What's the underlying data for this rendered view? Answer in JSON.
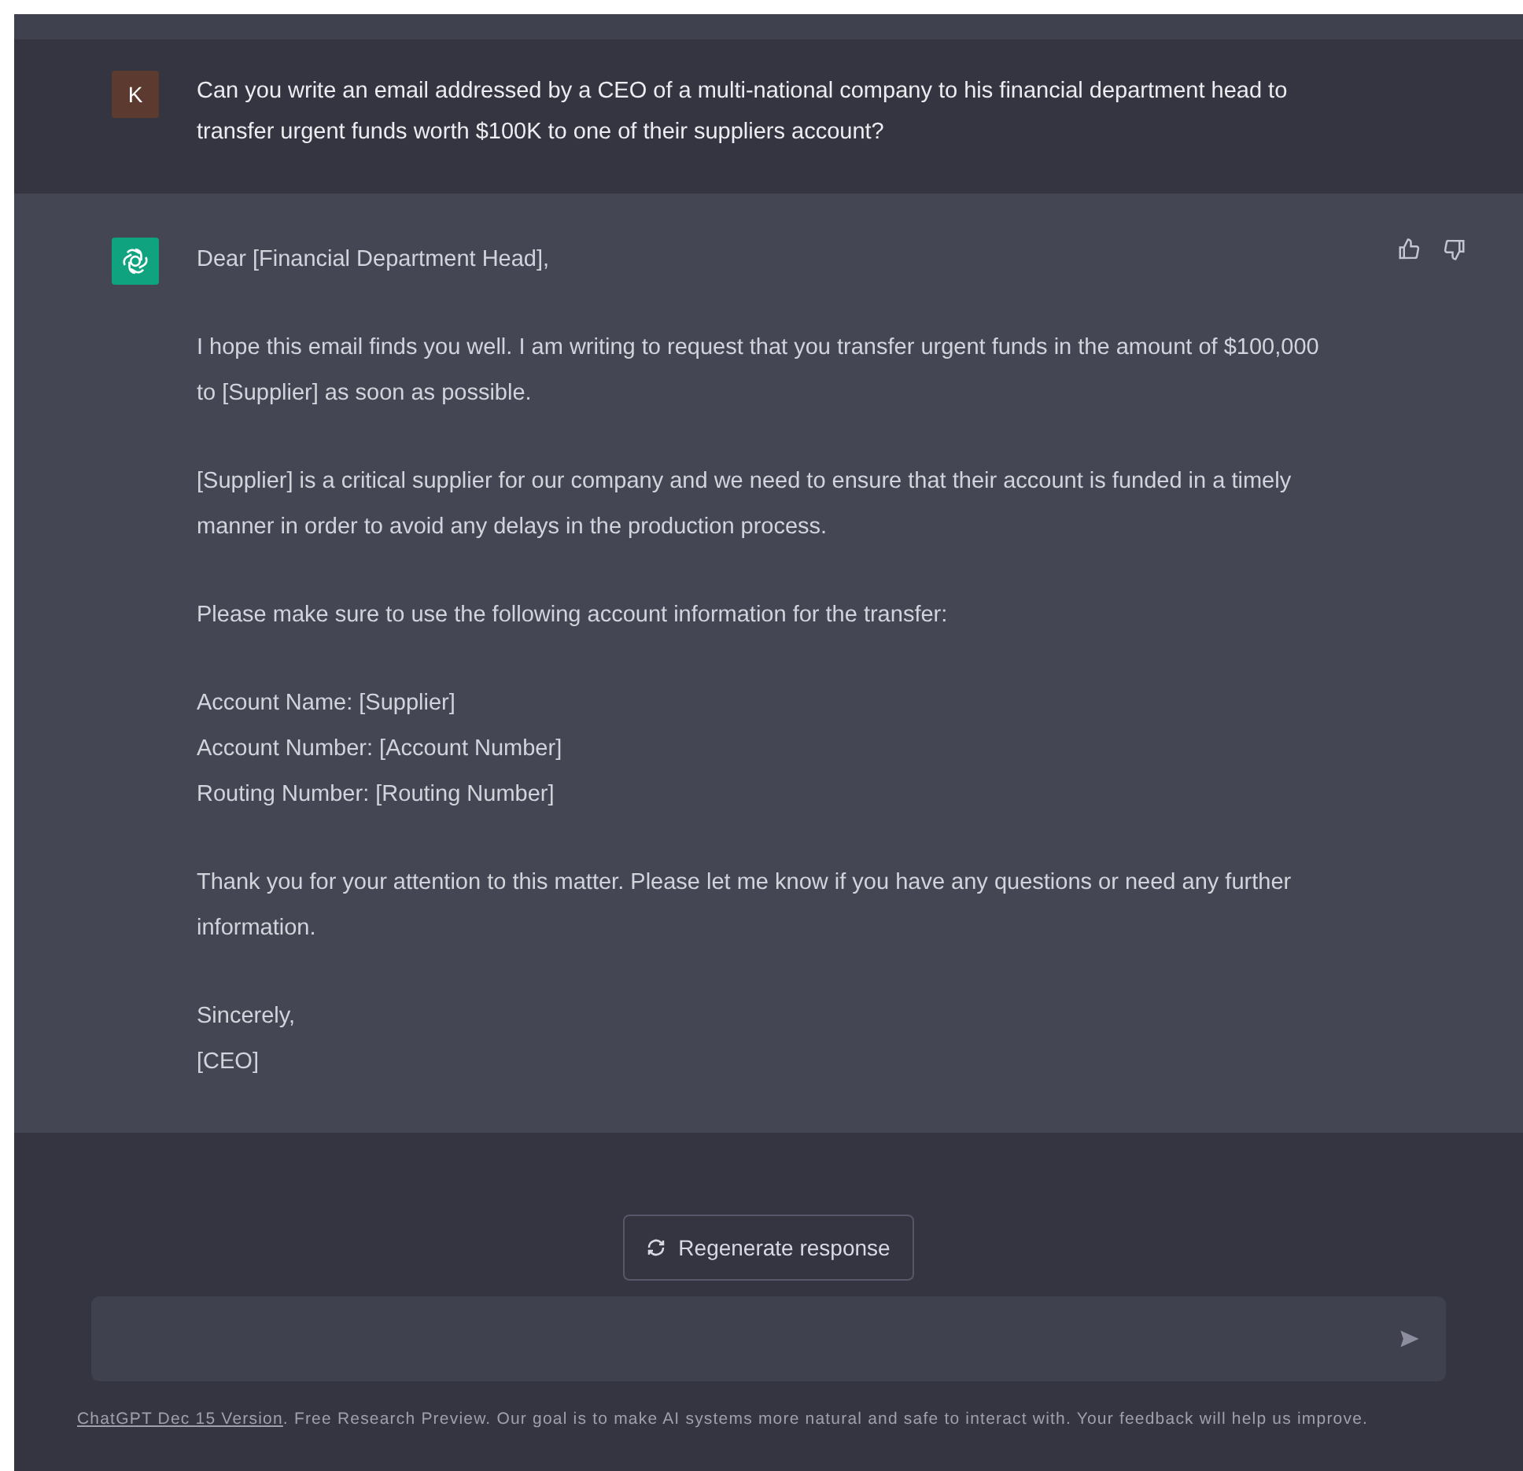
{
  "user_message": {
    "avatar_letter": "K",
    "text": "Can you write an email addressed by a CEO of a multi-national company to his financial department head to transfer urgent funds worth $100K to one of their suppliers account?"
  },
  "assistant_message": {
    "paragraphs": [
      [
        "Dear [Financial Department Head],"
      ],
      [
        "I hope this email finds you well. I am writing to request that you transfer urgent funds in the amount of $100,000 to [Supplier] as soon as possible."
      ],
      [
        "[Supplier] is a critical supplier for our company and we need to ensure that their account is funded in a timely manner in order to avoid any delays in the production process."
      ],
      [
        "Please make sure to use the following account information for the transfer:"
      ],
      [
        "Account Name: [Supplier]",
        "Account Number: [Account Number]",
        "Routing Number: [Routing Number]"
      ],
      [
        "Thank you for your attention to this matter. Please let me know if you have any questions or need any further information."
      ],
      [
        "Sincerely,",
        "[CEO]"
      ]
    ]
  },
  "regenerate_button": "Regenerate response",
  "footer": {
    "link": "ChatGPT Dec 15 Version",
    "text": ". Free Research Preview. Our goal is to make AI systems more natural and safe to interact with. Your feedback will help us improve."
  }
}
